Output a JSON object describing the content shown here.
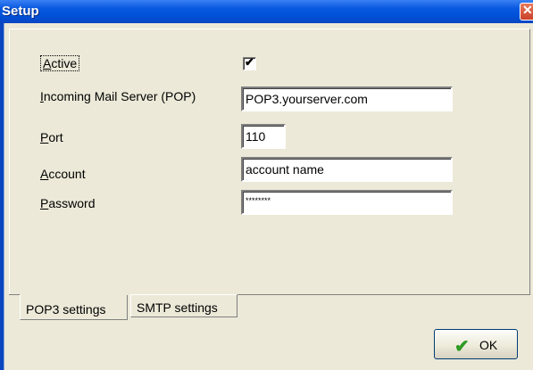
{
  "window": {
    "title": "Setup",
    "close_glyph": "✕",
    "close_icon": "close-icon"
  },
  "form": {
    "active_label": "Active",
    "active_checked": true,
    "check_glyph": "✔",
    "server_label": "Incoming Mail Server (POP)",
    "server_value": "POP3.yourserver.com",
    "port_label": "Port",
    "port_value": "110",
    "account_label": "Account",
    "account_value": "account name",
    "password_label": "Password",
    "password_value": "********"
  },
  "tabs": [
    {
      "label": "POP3 settings",
      "selected": true
    },
    {
      "label": "SMTP settings",
      "selected": false
    }
  ],
  "buttons": {
    "ok_label": "OK",
    "ok_icon": "checkmark-icon",
    "ok_glyph": "✔"
  },
  "colors": {
    "titlebar": "#0a5ae0",
    "background": "#ece9d8",
    "ok_check": "#2f9a24"
  }
}
